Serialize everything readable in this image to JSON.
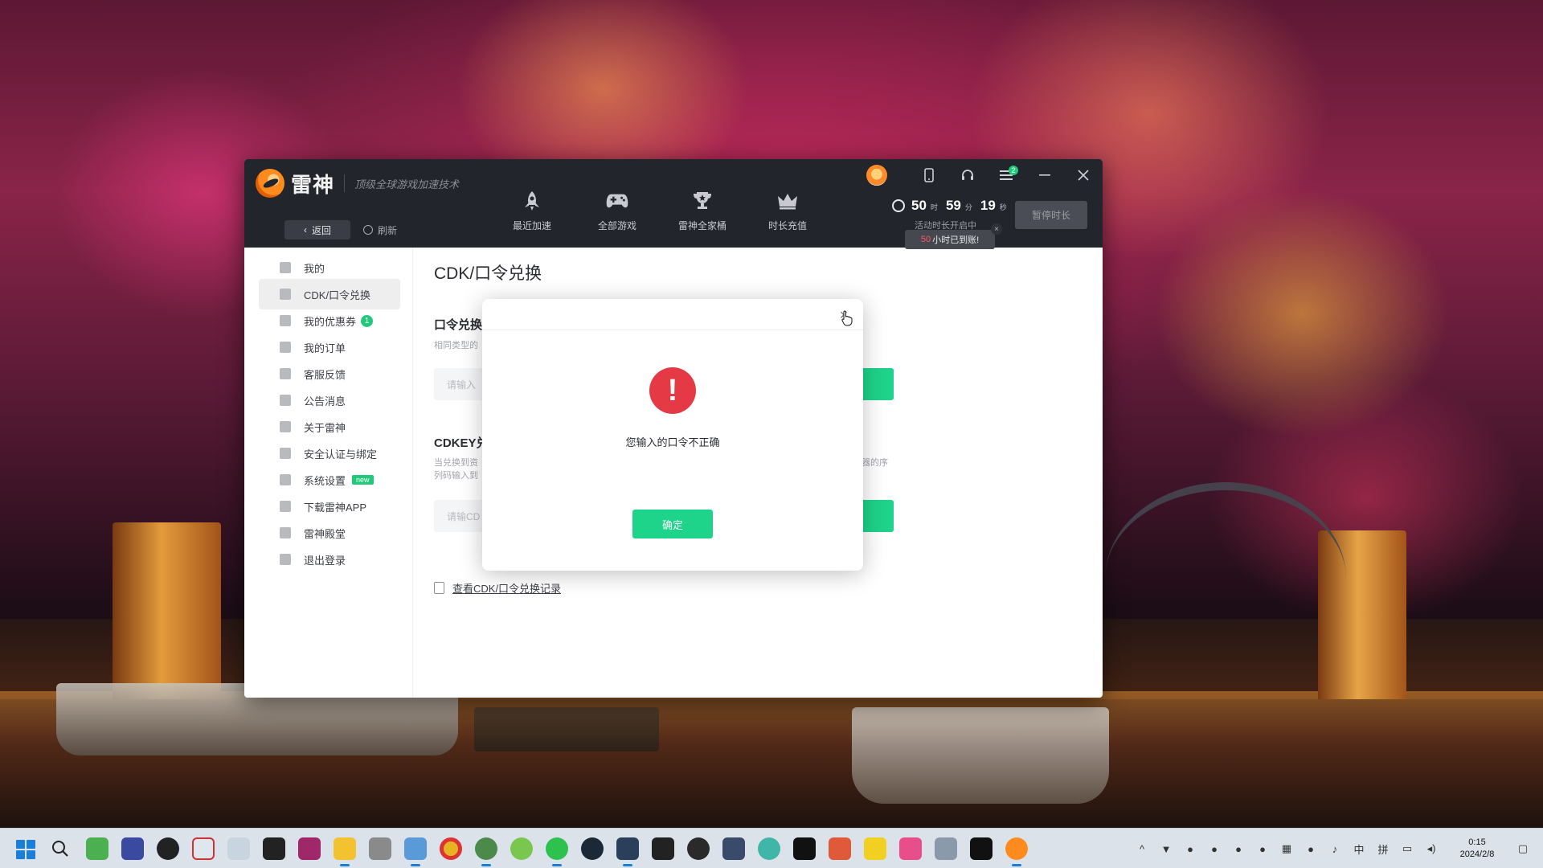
{
  "app": {
    "brand_name": "雷神",
    "slogan": "顶级全球游戏加速技术",
    "back_label": "返回",
    "refresh_label": "刷新",
    "nav": [
      {
        "label": "最近加速",
        "icon": "rocket-icon"
      },
      {
        "label": "全部游戏",
        "icon": "gamepad-icon"
      },
      {
        "label": "雷神全家桶",
        "icon": "trophy-icon"
      },
      {
        "label": "时长充值",
        "icon": "crown-icon"
      }
    ],
    "menu_badge": "2",
    "timer": {
      "hours": "50",
      "hours_unit": "时",
      "minutes": "59",
      "minutes_unit": "分",
      "seconds": "19",
      "seconds_unit": "秒",
      "subtitle": "活动时长开启中"
    },
    "pause_label": "暂停时长",
    "tooltip": {
      "number": "50",
      "text": "小时已到账!",
      "close": "×"
    }
  },
  "sidebar": {
    "items": [
      {
        "label": "我的"
      },
      {
        "label": "CDK/口令兑换",
        "active": true
      },
      {
        "label": "我的优惠券",
        "badge": "1"
      },
      {
        "label": "我的订单"
      },
      {
        "label": "客服反馈"
      },
      {
        "label": "公告消息"
      },
      {
        "label": "关于雷神"
      },
      {
        "label": "安全认证与绑定"
      },
      {
        "label": "系统设置",
        "tag": "new"
      },
      {
        "label": "下载雷神APP"
      },
      {
        "label": "雷神殿堂"
      },
      {
        "label": "退出登录"
      }
    ]
  },
  "main": {
    "page_title": "CDK/口令兑换",
    "section1": {
      "title": "口令兑换",
      "desc": "相同类型的",
      "placeholder": "请输入"
    },
    "section2": {
      "title": "CDKEY兑",
      "desc_line1": "当兑换到资",
      "desc_line2": "列码输入到",
      "desc_right": "器的序",
      "placeholder": "请输CD"
    },
    "history_link": "查看CDK/口令兑换记录"
  },
  "modal": {
    "close": "×",
    "alert_glyph": "!",
    "message": "您输入的口令不正确",
    "ok_label": "确定"
  },
  "taskbar": {
    "ime_lang": "中",
    "ime_mode": "拼",
    "time": "0:15",
    "date": "2024/2/8"
  }
}
